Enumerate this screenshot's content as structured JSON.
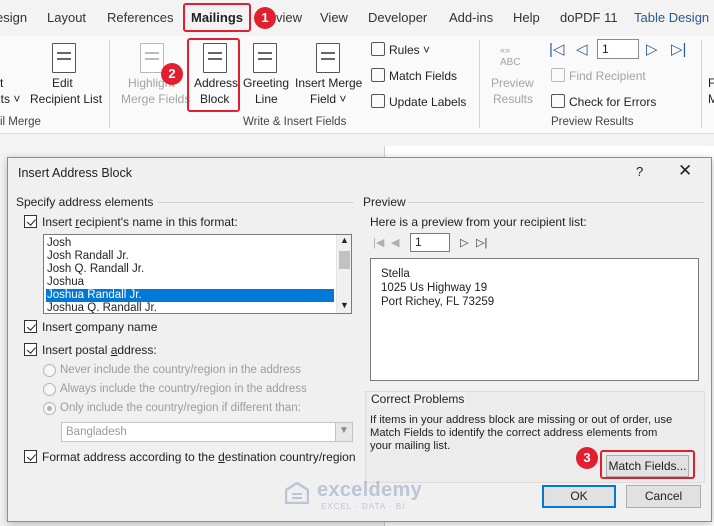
{
  "tabs": [
    "esign",
    "Layout",
    "References",
    "Mailings",
    "view",
    "View",
    "Developer",
    "Add-ins",
    "Help",
    "doPDF 11",
    "Table Design"
  ],
  "active_tab": "Mailings",
  "callouts": [
    "1",
    "2",
    "3"
  ],
  "ribbon": {
    "cut_label_1": "t",
    "cut_label_2": "nts ˅",
    "cut_group": "il Merge",
    "edit_recipient": [
      "Edit",
      "Recipient List"
    ],
    "highlight": [
      "Highlight",
      "Merge Fields"
    ],
    "address_block": [
      "Address",
      "Block"
    ],
    "greeting_line": [
      "Greeting",
      "Line"
    ],
    "insert_merge_field": [
      "Insert Merge",
      "Field ˅"
    ],
    "rules": "Rules ˅",
    "match_fields": "Match Fields",
    "update_labels": "Update Labels",
    "group_write_insert": "Write & Insert Fields",
    "preview_results": [
      "Preview",
      "Results"
    ],
    "preview_abc": "ABC",
    "record_value": "1",
    "find_recipient": "Find Recipient",
    "check_errors": "Check for Errors",
    "group_preview": "Preview Results",
    "cut_right_1": "Fi",
    "cut_right_2": "M"
  },
  "dialog": {
    "title": "Insert Address Block",
    "help": "?",
    "close": "✕",
    "specify_label": "Specify address elements",
    "insert_name_prefix": "Insert ",
    "insert_name_u": "r",
    "insert_name_suffix": "ecipient's name in this format:",
    "name_formats": [
      "Josh",
      "Josh Randall Jr.",
      "Josh Q. Randall Jr.",
      "Joshua",
      "Joshua Randall Jr.",
      "Joshua Q. Randall Jr."
    ],
    "selected_format": "Joshua Randall Jr.",
    "insert_company_prefix": "Insert ",
    "insert_company_u": "c",
    "insert_company_suffix": "ompany name",
    "insert_postal_prefix": "Insert postal ",
    "insert_postal_u": "a",
    "insert_postal_suffix": "ddress:",
    "radio_never": "Never include the country/region in the address",
    "radio_always": "Always include the country/region in the address",
    "radio_only": "Only include the country/region if different than:",
    "country": "Bangladesh",
    "format_prefix": "Format address according to the ",
    "format_u": "d",
    "format_suffix": "estination country/region",
    "preview_label": "Preview",
    "preview_desc": "Here is a preview from your recipient list:",
    "preview_record": "1",
    "preview_lines": [
      "Stella",
      "1025 Us Highway 19",
      "Port Richey, FL 73259"
    ],
    "correct_label": "Correct Problems",
    "correct_text": [
      "If items in your address block are missing or out of order, use",
      "Match Fields to identify the correct address elements from",
      "your mailing list."
    ],
    "match_fields_btn": "Match Fields...",
    "ok": "OK",
    "cancel": "Cancel"
  },
  "watermark": {
    "name": "exceldemy",
    "sub": "EXCEL · DATA · BI"
  },
  "colors": {
    "accent_red": "#e0202e",
    "selection_blue": "#0078d7",
    "tab_accent": "#2b579a"
  }
}
